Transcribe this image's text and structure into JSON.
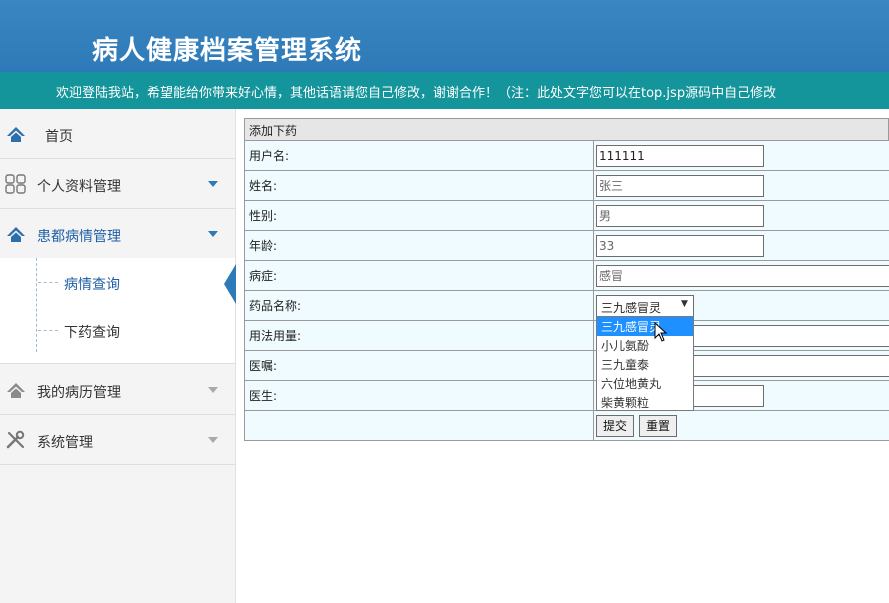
{
  "app": {
    "title": "病人健康档案管理系统",
    "marquee": "欢迎登陆我站，希望能给你带来好心情，其他话语请您自己修改，谢谢合作！（注：此处文字您可以在top.jsp源码中自己修改"
  },
  "sidebar": {
    "home": "首页",
    "personal": "个人资料管理",
    "illness": "患都病情管理",
    "sub_query": "病情查询",
    "sub_medicine": "下药查询",
    "records": "我的病历管理",
    "system": "系统管理"
  },
  "form": {
    "caption": "添加下药",
    "username_label": "用户名:",
    "username_value": "111111",
    "name_label": "姓名:",
    "name_value": "张三",
    "gender_label": "性别:",
    "gender_value": "男",
    "age_label": "年龄:",
    "age_value": "33",
    "disease_label": "病症:",
    "disease_value": "感冒",
    "drug_label": "药品名称:",
    "drug_selected": "三九感冒灵",
    "drug_options": [
      "三九感冒灵",
      "小儿氨酚",
      "三九童泰",
      "六位地黄丸",
      "柴黄颗粒"
    ],
    "usage_label": "用法用量:",
    "advice_label": "医嘱:",
    "doctor_label": "医生:",
    "submit": "提交",
    "reset": "重置"
  },
  "colors": {
    "header": "#2e7ab8",
    "marquee_bar": "#14949b",
    "accent": "#1f5fa6",
    "selected_option": "#1e90ff"
  }
}
